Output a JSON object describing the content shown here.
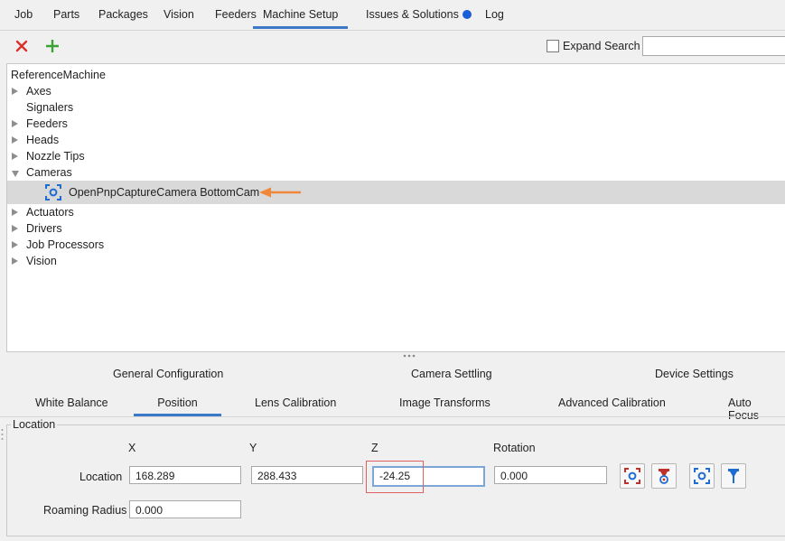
{
  "top_tabs": [
    {
      "label": "Job"
    },
    {
      "label": "Parts"
    },
    {
      "label": "Packages"
    },
    {
      "label": "Vision"
    },
    {
      "label": "Feeders"
    },
    {
      "label": "Machine Setup",
      "active": true
    },
    {
      "label": "Issues & Solutions",
      "badge_color": "#1a5fd6"
    },
    {
      "label": "Log"
    }
  ],
  "toolbar": {
    "delete_icon": "close-icon",
    "add_icon": "plus-icon",
    "expand_label": "Expand",
    "search_label": "Search",
    "search_value": ""
  },
  "tree": {
    "root": "ReferenceMachine",
    "items": [
      {
        "label": "Axes",
        "state": "collapsed"
      },
      {
        "label": "Signalers",
        "state": "leaf"
      },
      {
        "label": "Feeders",
        "state": "collapsed"
      },
      {
        "label": "Heads",
        "state": "collapsed"
      },
      {
        "label": "Nozzle Tips",
        "state": "collapsed"
      },
      {
        "label": "Cameras",
        "state": "expanded"
      },
      {
        "label": "OpenPnpCaptureCamera BottomCam",
        "state": "selected",
        "icon": "camera-icon"
      },
      {
        "label": "Actuators",
        "state": "collapsed"
      },
      {
        "label": "Drivers",
        "state": "collapsed"
      },
      {
        "label": "Job Processors",
        "state": "collapsed"
      },
      {
        "label": "Vision",
        "state": "collapsed"
      }
    ],
    "annotation_arrow_color": "#f0883c"
  },
  "config_tabs_row1": [
    {
      "label": "General Configuration"
    },
    {
      "label": "Camera Settling"
    },
    {
      "label": "Device Settings"
    }
  ],
  "config_tabs_row2": [
    {
      "label": "White Balance"
    },
    {
      "label": "Position",
      "active": true
    },
    {
      "label": "Lens Calibration"
    },
    {
      "label": "Image Transforms"
    },
    {
      "label": "Advanced Calibration"
    },
    {
      "label": "Auto Focus"
    }
  ],
  "location_panel": {
    "title": "Location",
    "columns": [
      "X",
      "Y",
      "Z",
      "Rotation"
    ],
    "location_label": "Location",
    "x": "168.289",
    "y": "288.433",
    "z": "-24.25",
    "rotation": "0.000",
    "roaming_label": "Roaming Radius",
    "roaming_value": "0.000",
    "buttons": [
      {
        "icon": "capture-camera-location-icon"
      },
      {
        "icon": "capture-tool-location-icon"
      },
      {
        "icon": "move-camera-to-location-icon"
      },
      {
        "icon": "move-tool-to-location-icon"
      }
    ]
  },
  "colors": {
    "accent": "#3c78c8",
    "delete_red": "#d9312b",
    "add_green": "#3aa336",
    "camera_blue": "#1e6bd1",
    "highlight_red": "#e06060"
  }
}
